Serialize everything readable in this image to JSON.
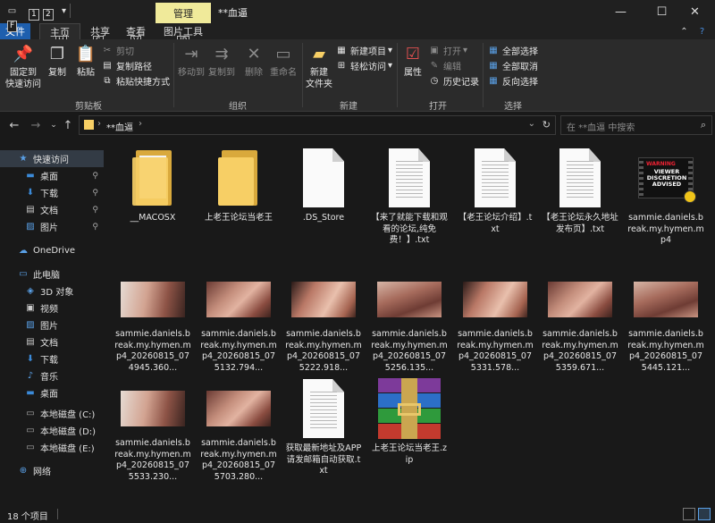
{
  "window": {
    "title": "**血逼",
    "context_tab": "管理",
    "qat_keytips": [
      "1",
      "2"
    ],
    "controls": {
      "minimize": "—",
      "maximize": "☐",
      "close": "✕"
    }
  },
  "tabs": [
    {
      "label": "文件",
      "keytip": "F"
    },
    {
      "label": "主页",
      "keytip": "H"
    },
    {
      "label": "共享",
      "keytip": "S"
    },
    {
      "label": "查看",
      "keytip": "V"
    },
    {
      "label": "图片工具",
      "keytip": "JP"
    }
  ],
  "ribbon": {
    "clipboard": {
      "label": "剪贴板",
      "pin": "固定到\n快速访问",
      "copy": "复制",
      "paste": "粘贴",
      "cut": "剪切",
      "copy_path": "复制路径",
      "paste_shortcut": "粘贴快捷方式"
    },
    "organize": {
      "label": "组织",
      "move_to": "移动到",
      "copy_to": "复制到",
      "delete": "删除",
      "rename": "重命名"
    },
    "new": {
      "label": "新建",
      "new_folder": "新建\n文件夹",
      "new_item": "新建项目",
      "easy_access": "轻松访问"
    },
    "open": {
      "label": "打开",
      "properties": "属性",
      "open": "打开",
      "edit": "编辑",
      "history": "历史记录"
    },
    "select": {
      "label": "选择",
      "select_all": "全部选择",
      "select_none": "全部取消",
      "invert": "反向选择"
    }
  },
  "address": {
    "path": "**血逼",
    "search_placeholder": "在 **血逼 中搜索"
  },
  "sidebar": {
    "items": [
      {
        "label": "快速访问",
        "icon": "star-icon",
        "level": 0,
        "selected": true
      },
      {
        "label": "桌面",
        "icon": "desktop-icon",
        "level": 1,
        "pinned": true
      },
      {
        "label": "下载",
        "icon": "download-icon",
        "level": 1,
        "pinned": true
      },
      {
        "label": "文档",
        "icon": "document-icon",
        "level": 1,
        "pinned": true
      },
      {
        "label": "图片",
        "icon": "pictures-icon",
        "level": 1,
        "pinned": true
      },
      {
        "label": "OneDrive",
        "icon": "cloud-icon",
        "level": 0
      },
      {
        "label": "此电脑",
        "icon": "computer-icon",
        "level": 0
      },
      {
        "label": "3D 对象",
        "icon": "cube-icon",
        "level": 1
      },
      {
        "label": "视频",
        "icon": "video-icon",
        "level": 1
      },
      {
        "label": "图片",
        "icon": "pictures-icon",
        "level": 1
      },
      {
        "label": "文档",
        "icon": "document-icon",
        "level": 1
      },
      {
        "label": "下载",
        "icon": "download-icon",
        "level": 1
      },
      {
        "label": "音乐",
        "icon": "music-icon",
        "level": 1
      },
      {
        "label": "桌面",
        "icon": "desktop-icon",
        "level": 1
      },
      {
        "label": "本地磁盘 (C:)",
        "icon": "drive-icon",
        "level": 1
      },
      {
        "label": "本地磁盘 (D:)",
        "icon": "drive-icon",
        "level": 1
      },
      {
        "label": "本地磁盘 (E:)",
        "icon": "drive-icon",
        "level": 1
      },
      {
        "label": "网络",
        "icon": "network-icon",
        "level": 0
      }
    ]
  },
  "files": [
    {
      "name": "__MACOSX",
      "type": "folder-doc"
    },
    {
      "name": "上老王论坛当老王",
      "type": "folder"
    },
    {
      "name": ".DS_Store",
      "type": "blank"
    },
    {
      "name": "【来了就能下载和观看的论坛,纯免费！】.txt",
      "type": "txt"
    },
    {
      "name": "【老王论坛介绍】.txt",
      "type": "txt"
    },
    {
      "name": "【老王论坛永久地址发布页】.txt",
      "type": "txt"
    },
    {
      "name": "sammie.daniels.break.my.hymen.mp4",
      "type": "warning",
      "warning_line1": "WARNING",
      "warning_line2": "VIEWER DISCRETION ADVISED"
    },
    {
      "name": "sammie.daniels.break.my.hymen.mp4_20260815_074945.360...",
      "type": "video"
    },
    {
      "name": "sammie.daniels.break.my.hymen.mp4_20260815_075132.794...",
      "type": "video"
    },
    {
      "name": "sammie.daniels.break.my.hymen.mp4_20260815_075222.918...",
      "type": "video"
    },
    {
      "name": "sammie.daniels.break.my.hymen.mp4_20260815_075256.135...",
      "type": "video"
    },
    {
      "name": "sammie.daniels.break.my.hymen.mp4_20260815_075331.578...",
      "type": "video"
    },
    {
      "name": "sammie.daniels.break.my.hymen.mp4_20260815_075359.671...",
      "type": "video"
    },
    {
      "name": "sammie.daniels.break.my.hymen.mp4_20260815_075445.121...",
      "type": "video"
    },
    {
      "name": "sammie.daniels.break.my.hymen.mp4_20260815_075533.230...",
      "type": "video"
    },
    {
      "name": "sammie.daniels.break.my.hymen.mp4_20260815_075703.280...",
      "type": "video"
    },
    {
      "name": "获取最新地址及APP请发邮箱自动获取.txt",
      "type": "txt"
    },
    {
      "name": "上老王论坛当老王.zip",
      "type": "zip"
    }
  ],
  "status": {
    "count": "18 个项目"
  },
  "colors": {
    "background": "#191919",
    "ribbon": "#2b2b2b",
    "file_tab": "#1e5fae",
    "context_tab": "#f0ea9a",
    "folder": "#f7cf65",
    "selected_nav": "#333b45"
  }
}
